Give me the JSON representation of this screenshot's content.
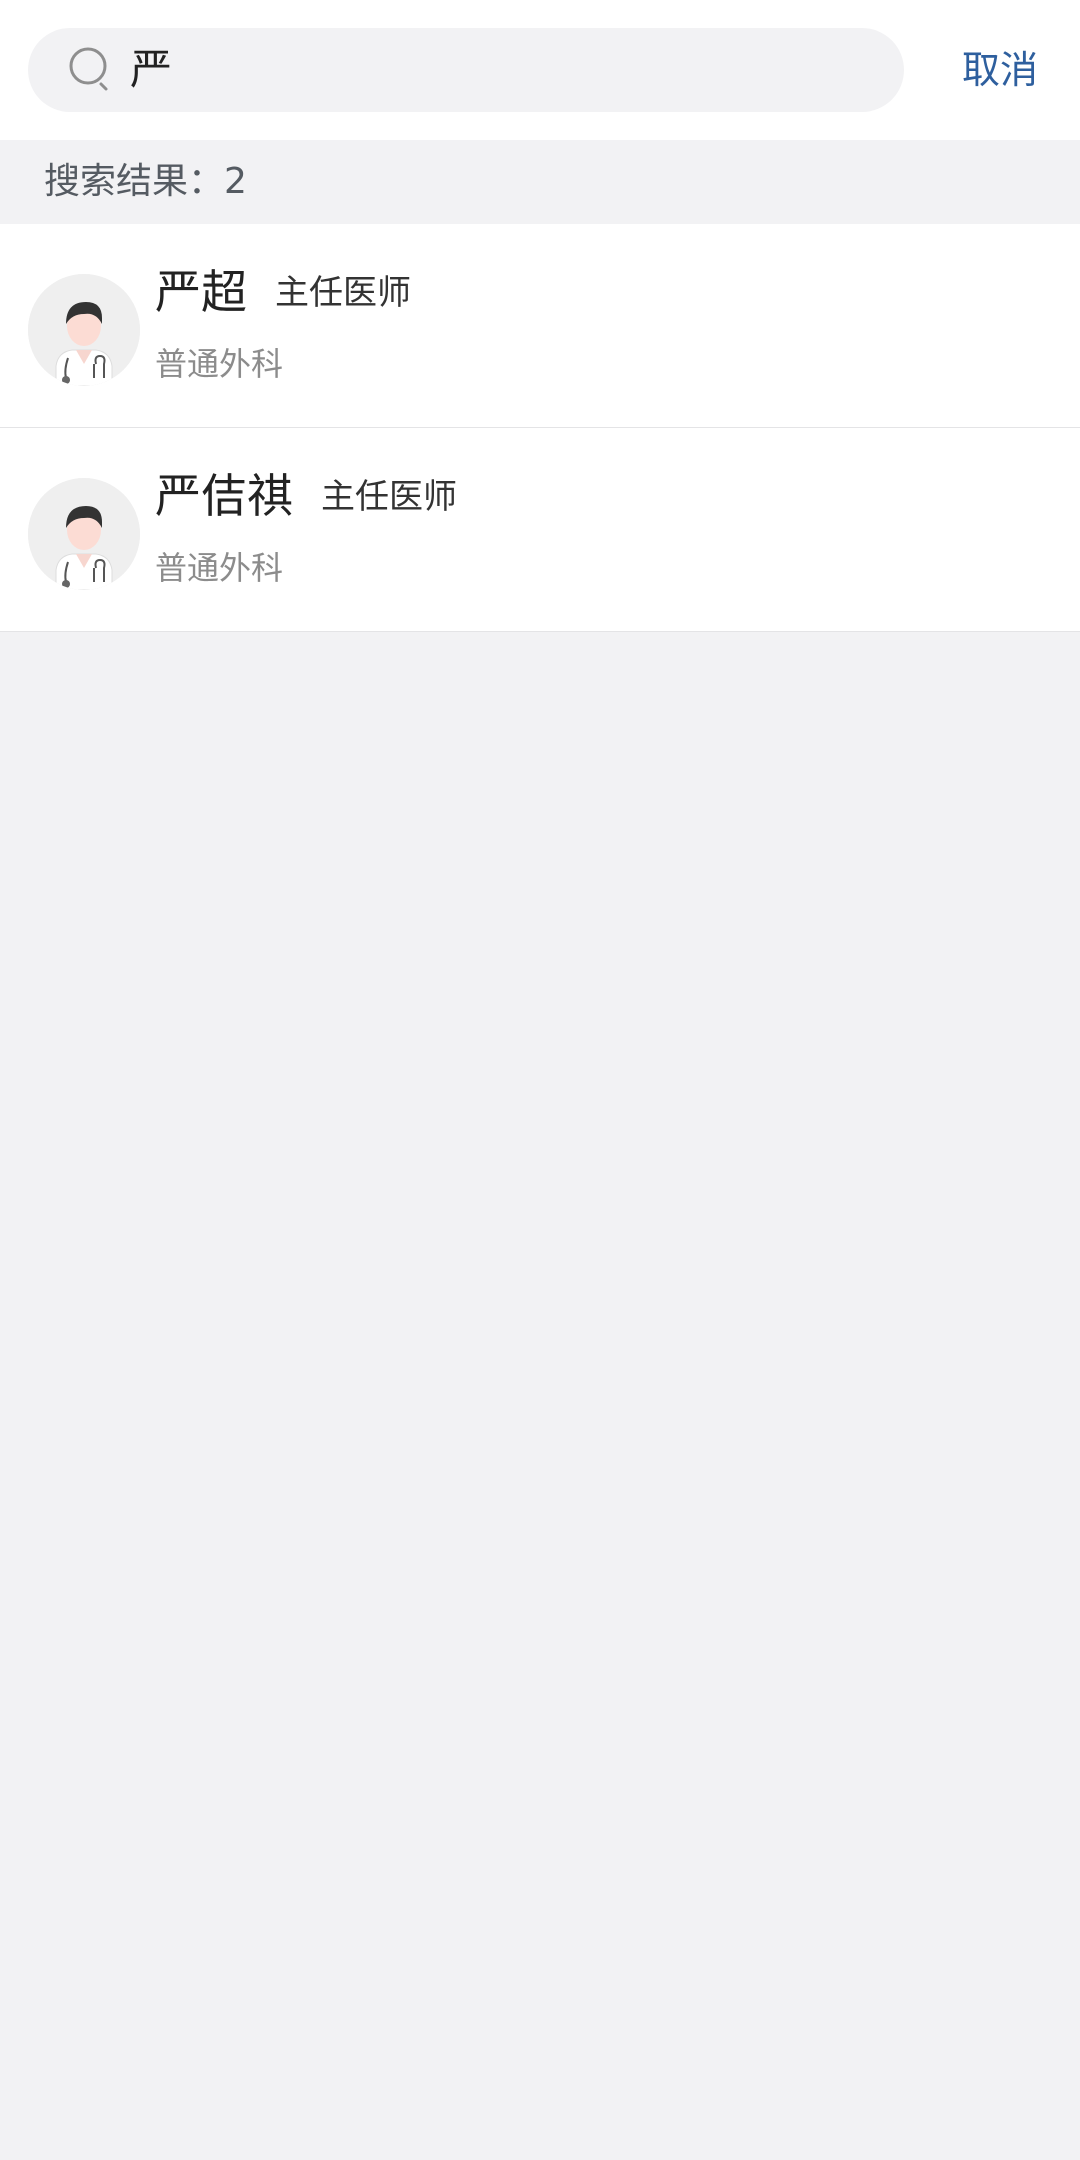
{
  "search": {
    "query": "严",
    "cancel_label": "取消"
  },
  "results": {
    "count_label": "搜索结果：2",
    "items": [
      {
        "name": "严超",
        "title": "主任医师",
        "department": "普通外科"
      },
      {
        "name": "严佶祺",
        "title": "主任医师",
        "department": "普通外科"
      }
    ]
  },
  "colors": {
    "accent": "#2e5f9e",
    "background": "#f2f2f4",
    "card": "#ffffff",
    "secondary_text": "#8c8c8c"
  },
  "icons": {
    "search": "search-icon",
    "avatar": "doctor-avatar-icon"
  }
}
